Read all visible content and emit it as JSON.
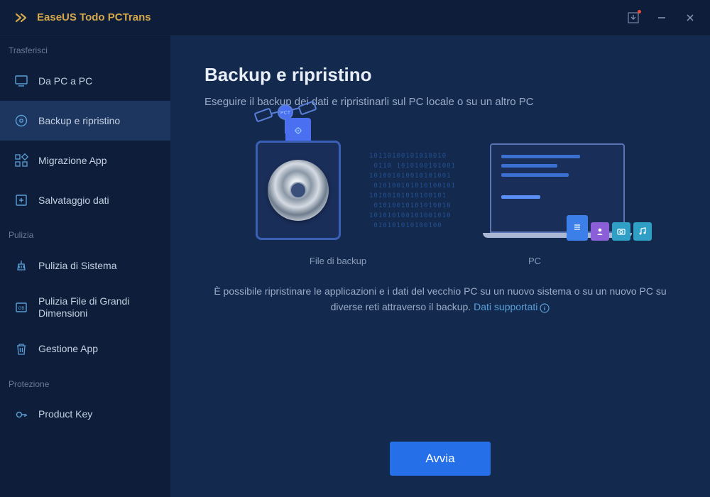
{
  "app": {
    "title": "EaseUS Todo PCTrans"
  },
  "sidebar": {
    "sections": {
      "transfer": {
        "label": "Trasferisci"
      },
      "clean": {
        "label": "Pulizia"
      },
      "protect": {
        "label": "Protezione"
      }
    },
    "items": {
      "pc2pc": {
        "label": "Da PC a PC"
      },
      "backup": {
        "label": "Backup e ripristino"
      },
      "appmig": {
        "label": "Migrazione App"
      },
      "datasave": {
        "label": "Salvataggio dati"
      },
      "sysclean": {
        "label": "Pulizia di Sistema"
      },
      "bigfile": {
        "label": "Pulizia File di Grandi Dimensioni"
      },
      "appmgr": {
        "label": "Gestione App"
      },
      "pkey": {
        "label": "Product Key"
      }
    }
  },
  "main": {
    "title": "Backup e ripristino",
    "subtitle": "Eseguire il backup dei dati e ripristinarli sul PC locale o su un altro PC",
    "caption_left": "File di backup",
    "caption_right": "PC",
    "satellite_label": "PCT",
    "desc_1": "È possibile ripristinare le applicazioni e i dati del vecchio PC su un nuovo sistema o su un nuovo PC su diverse reti attraverso il backup. ",
    "link": "Dati supportati",
    "cta": "Avvia"
  }
}
